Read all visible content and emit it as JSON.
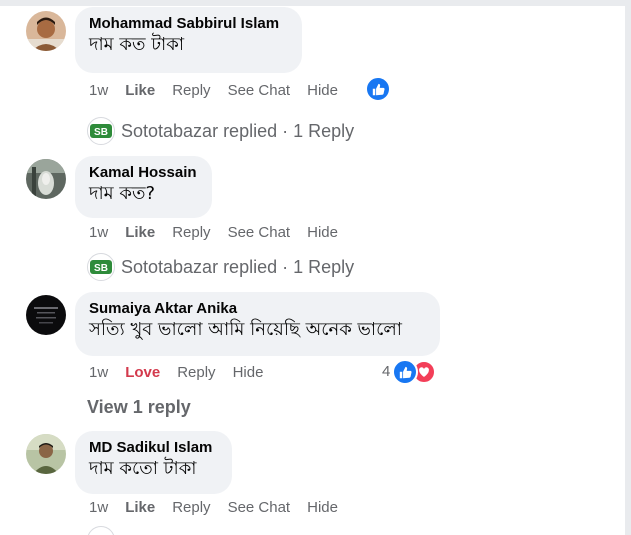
{
  "comments": [
    {
      "author": "Mohammad Sabbirul Islam",
      "text": "দাম কত টাকা",
      "time": "1w",
      "reaction_label": "Like",
      "reply_label": "Reply",
      "see_chat_label": "See Chat",
      "hide_label": "Hide",
      "reactions": [
        "like"
      ],
      "replies": {
        "page": "Sototabazar",
        "summary": "Sototabazar replied · 1 Reply"
      }
    },
    {
      "author": "Kamal Hossain",
      "text": "দাম কত?",
      "time": "1w",
      "reaction_label": "Like",
      "reply_label": "Reply",
      "see_chat_label": "See Chat",
      "hide_label": "Hide",
      "replies": {
        "page": "Sototabazar",
        "summary": "Sototabazar replied · 1 Reply"
      }
    },
    {
      "author": "Sumaiya Aktar Anika",
      "text": "সত্যি খুব ভালো আমি নিয়েছি অনেক ভালো",
      "time": "1w",
      "reaction_label": "Love",
      "reply_label": "Reply",
      "hide_label": "Hide",
      "reaction_count": "4",
      "reactions": [
        "like",
        "love"
      ],
      "view_replies": "View 1 reply"
    },
    {
      "author": "MD Sadikul Islam",
      "text": "দাম কতো টাকা",
      "time": "1w",
      "reaction_label": "Like",
      "reply_label": "Reply",
      "see_chat_label": "See Chat",
      "hide_label": "Hide"
    }
  ],
  "colors": {
    "like_blue": "#1877f2",
    "love_red": "#f33e58",
    "love_text": "#d33a4d",
    "bubble": "#f0f2f5",
    "meta": "#65676b"
  },
  "page_badge": {
    "initials": "SB",
    "color": "#2e8b3a"
  }
}
